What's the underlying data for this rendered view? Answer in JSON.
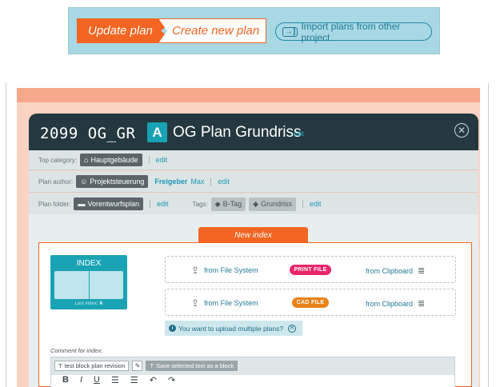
{
  "toolbar": {
    "update_label": "Update plan",
    "create_label": "Create new plan",
    "import_label": "Import plans from other project"
  },
  "plan": {
    "code": "2099 OG_GR",
    "index_letter": "A",
    "name": "OG Plan Grundriss",
    "edit_label": "edit"
  },
  "meta": {
    "top_category_label": "Top category:",
    "top_category_value": "Hauptgebäude",
    "author_label": "Plan author:",
    "author_value": "Projektsteuerung",
    "approver_strong": "Freigeber",
    "approver_name": "Max",
    "folder_label": "Plan folder:",
    "folder_value": "Vorentwurfsplan",
    "tags_label": "Tags:",
    "tags": [
      "B-Tag",
      "Grundriss"
    ],
    "edit_label": "edit"
  },
  "new_index": {
    "tab_label": "New index",
    "card_title": "INDEX",
    "last_index_label": "Last index:",
    "last_index_value": "A",
    "rows": [
      {
        "from_fs": "from File System",
        "pill": "PRINT FILE",
        "pill_color": "#e8266a",
        "from_clip": "from Clipboard"
      },
      {
        "from_fs": "from File System",
        "pill": "CAD FILE",
        "pill_color": "#e8821a",
        "from_clip": "from Clipboard"
      }
    ],
    "multi_upload": "You want to upload multiple plans?",
    "comment_label": "Comment for index:",
    "block_button": "test block plan revision",
    "save_block_button": "Save selected text as a block"
  },
  "colors": {
    "accent": "#f26522",
    "teal": "#1aa3b5",
    "header_dark": "#23393f"
  }
}
